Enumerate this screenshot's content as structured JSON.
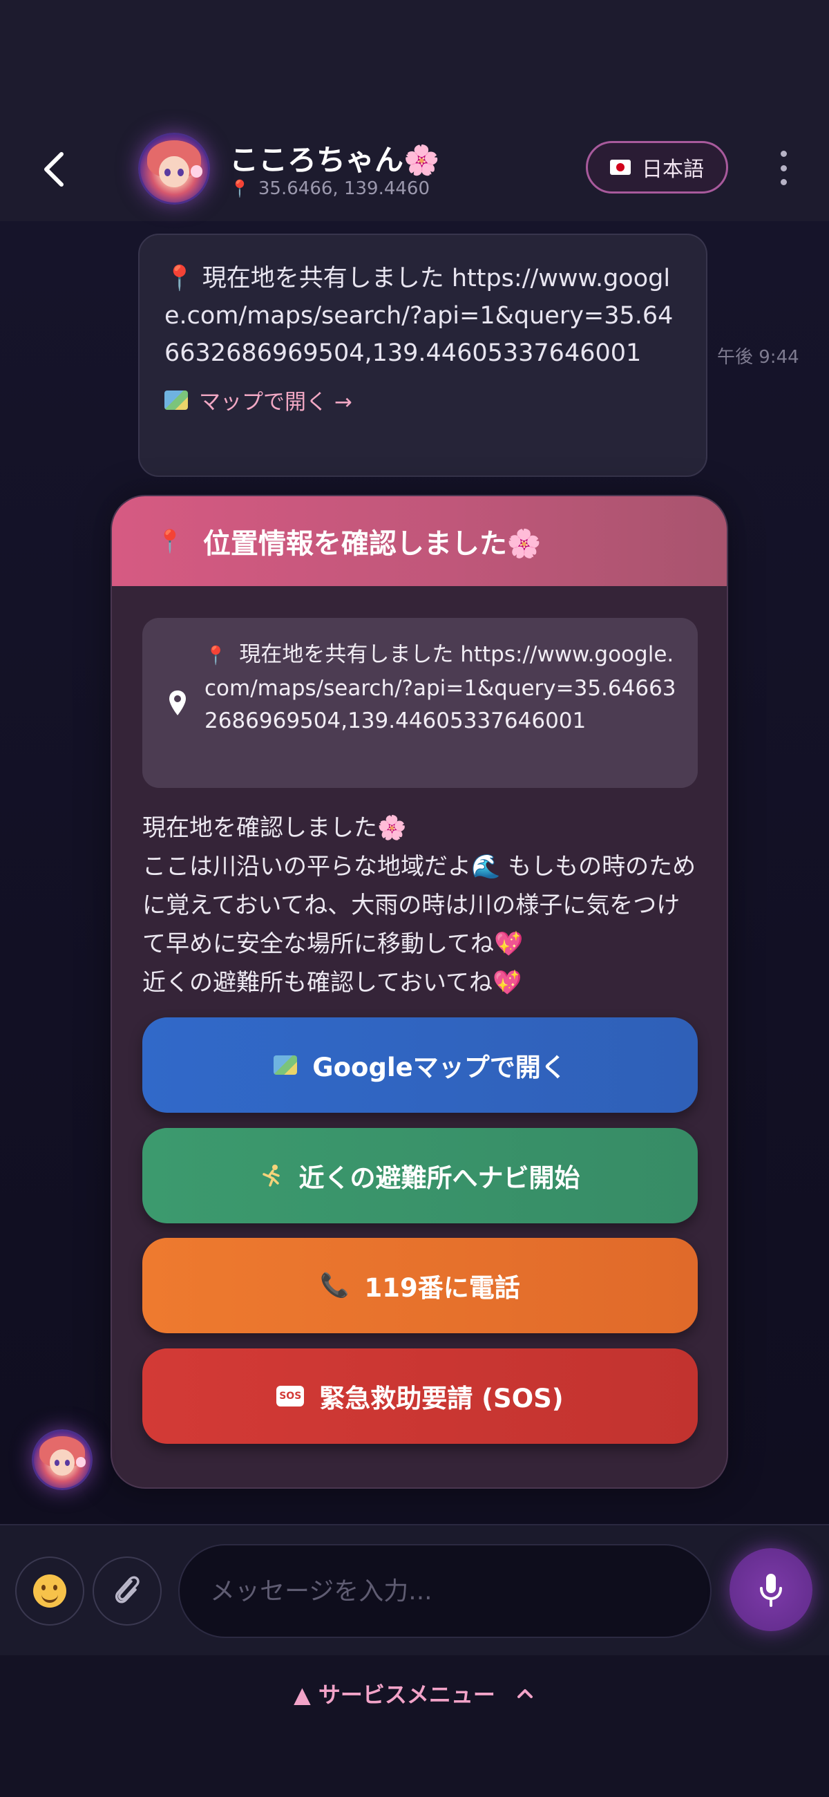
{
  "header": {
    "contact_name": "こころちゃん🌸",
    "coordinates": "35.6466, 139.4460",
    "language_label": "日本語"
  },
  "messages": [
    {
      "text": "📍 現在地を共有しました https://www.google.com/maps/search/?api=1&query=35.646632686969504,139.44605337646001",
      "link_label": "マップで開く →",
      "timestamp": "午後 9:44"
    }
  ],
  "location_card": {
    "title": "位置情報を確認しました🌸",
    "location_text": "現在地を共有しました https://www.google.com/maps/search/?api=1&query=35.646632686969504,139.44605337646001",
    "body": "現在地を確認しました🌸\nここは川沿いの平らな地域だよ🌊 もしもの時のために覚えておいてね、大雨の時は川の様子に気をつけて早めに安全な場所に移動してね💖\n近くの避難所も確認しておいてね💖",
    "buttons": {
      "open_map": "Googleマップで開く",
      "navigate_shelter": "近くの避難所へナビ開始",
      "call_119": "119番に電話",
      "sos": "緊急救助要請 (SOS)"
    }
  },
  "composer": {
    "placeholder": "メッセージを入力..."
  },
  "footer": {
    "service_menu": "▲ サービスメニュー"
  },
  "colors": {
    "accent_pink": "#d65a82",
    "map_button": "#3169c9",
    "nav_button": "#3c9a6e",
    "call_button": "#ee7a2f",
    "sos_button": "#d33a36",
    "mic_purple": "#7c3aa8"
  },
  "icons": [
    "back-icon",
    "location-pin-icon",
    "flag-jp-icon",
    "more-vertical-icon",
    "map-icon",
    "map-marker-icon",
    "runner-icon",
    "phone-icon",
    "sos-icon",
    "smiley-icon",
    "paperclip-icon",
    "microphone-icon",
    "chevron-up-icon"
  ]
}
